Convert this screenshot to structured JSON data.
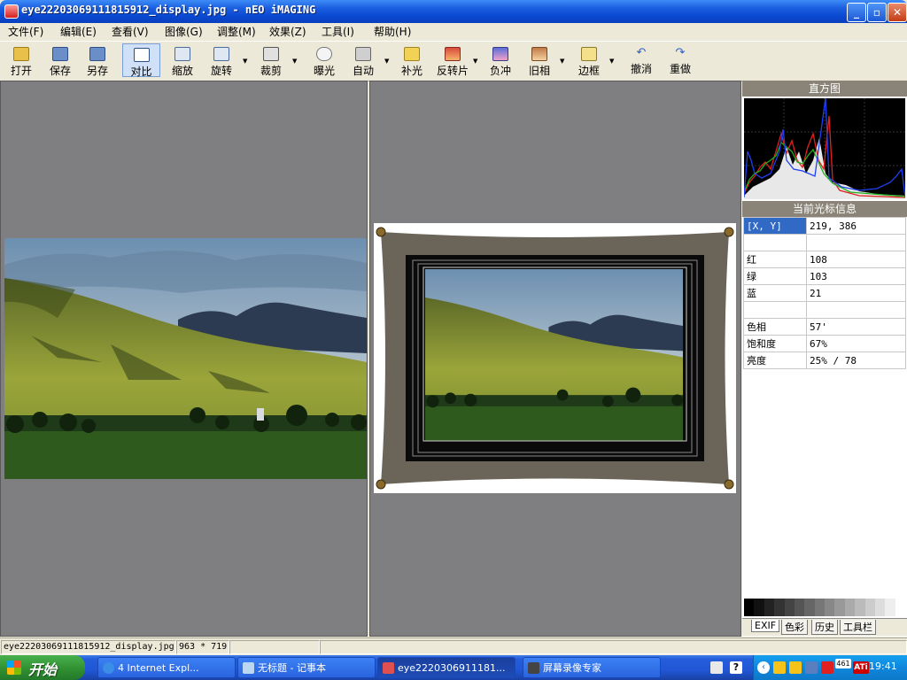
{
  "window": {
    "title": "eye22203069111815912_display.jpg - nEO iMAGING",
    "min_symbol": "_",
    "max_symbol": "▫",
    "close_symbol": "✕"
  },
  "menu": [
    "文件(F)",
    "编辑(E)",
    "查看(V)",
    "图像(G)",
    "调整(M)",
    "效果(Z)",
    "工具(I)",
    "帮助(H)"
  ],
  "toolbar": [
    {
      "label": "打开",
      "icon": "open-folder-icon"
    },
    {
      "label": "保存",
      "icon": "save-disk-icon"
    },
    {
      "label": "另存",
      "icon": "save-as-icon"
    },
    {
      "label": "对比",
      "icon": "compare-icon",
      "active": true
    },
    {
      "label": "缩放",
      "icon": "zoom-icon"
    },
    {
      "label": "旋转",
      "icon": "rotate-icon"
    },
    {
      "label": "裁剪",
      "icon": "crop-icon"
    },
    {
      "label": "曝光",
      "icon": "exposure-icon"
    },
    {
      "label": "自动",
      "icon": "auto-icon"
    },
    {
      "label": "补光",
      "icon": "fill-light-icon"
    },
    {
      "label": "反转片",
      "icon": "slide-film-icon"
    },
    {
      "label": "负冲",
      "icon": "cross-process-icon"
    },
    {
      "label": "旧相",
      "icon": "old-photo-icon"
    },
    {
      "label": "边框",
      "icon": "border-icon"
    },
    {
      "label": "撤消",
      "icon": "undo-icon"
    },
    {
      "label": "重做",
      "icon": "redo-icon"
    }
  ],
  "side": {
    "histogram_title": "直方图",
    "cursor_title": "当前光标信息",
    "info": [
      {
        "k": "[X, Y]",
        "v": "219, 386"
      },
      {
        "k": "",
        "v": ""
      },
      {
        "k": "红",
        "v": "108"
      },
      {
        "k": "绿",
        "v": "103"
      },
      {
        "k": "蓝",
        "v": "21"
      },
      {
        "k": "",
        "v": ""
      },
      {
        "k": "色相",
        "v": "57'"
      },
      {
        "k": "饱和度",
        "v": "67%"
      },
      {
        "k": "亮度",
        "v": "25% / 78"
      }
    ],
    "tabs": [
      "EXIF",
      "色彩",
      "历史",
      "工具栏"
    ]
  },
  "status": {
    "filename": "eye22203069111815912_display.jpg",
    "dimensions": "963 * 719"
  },
  "taskbar": {
    "start": "开始",
    "tasks": [
      "4 Internet Expl...",
      "无标题 - 记事本",
      "eye2220306911181...",
      "屏幕录像专家"
    ],
    "clock": "19:41",
    "badge": "461",
    "ati": "ATi"
  },
  "colors": {
    "title_blue": "#0a49d2",
    "pane_gray": "#7f7e80",
    "panel_header": "#8a8478",
    "selected_cell": "#316ac5"
  }
}
